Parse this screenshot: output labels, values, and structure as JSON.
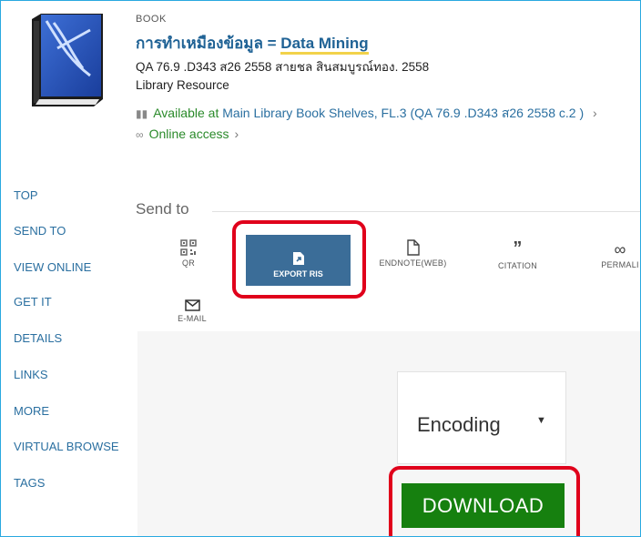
{
  "record": {
    "doc_type": "BOOK",
    "title_thai": "การทำเหมืองข้อมูล = ",
    "title_en": "Data Mining",
    "call_line": "QA 76.9 .D343 ส26 2558 สายชล สินสมบูรณ์ทอง. 2558",
    "resource_type": "Library Resource",
    "availability_status": "Available at",
    "availability_location": "Main Library  Book Shelves, FL.3 (QA 76.9 .D343 ส26 2558 c.2 )",
    "online_access": "Online access"
  },
  "nav": {
    "items": [
      "TOP",
      "SEND TO",
      "VIEW ONLINE",
      "GET IT",
      "DETAILS",
      "LINKS",
      "MORE",
      "VIRTUAL BROWSE",
      "TAGS"
    ]
  },
  "send_to": {
    "label": "Send to",
    "actions": {
      "qr": "QR",
      "export_ris": "EXPORT RIS",
      "endnote": "ENDNOTE(WEB)",
      "citation": "CITATION",
      "permalink": "PERMALI",
      "email": "E-MAIL"
    }
  },
  "export_panel": {
    "encoding_label": "Encoding",
    "download_label": "DOWNLOAD"
  },
  "colors": {
    "frame_border": "#29a9e0",
    "link_blue": "#2a6fa0",
    "title_blue": "#1f6295",
    "available_green": "#2a8a2a",
    "export_button": "#3b6d98",
    "download_button": "#16800f",
    "highlight_red": "#e0001b"
  }
}
